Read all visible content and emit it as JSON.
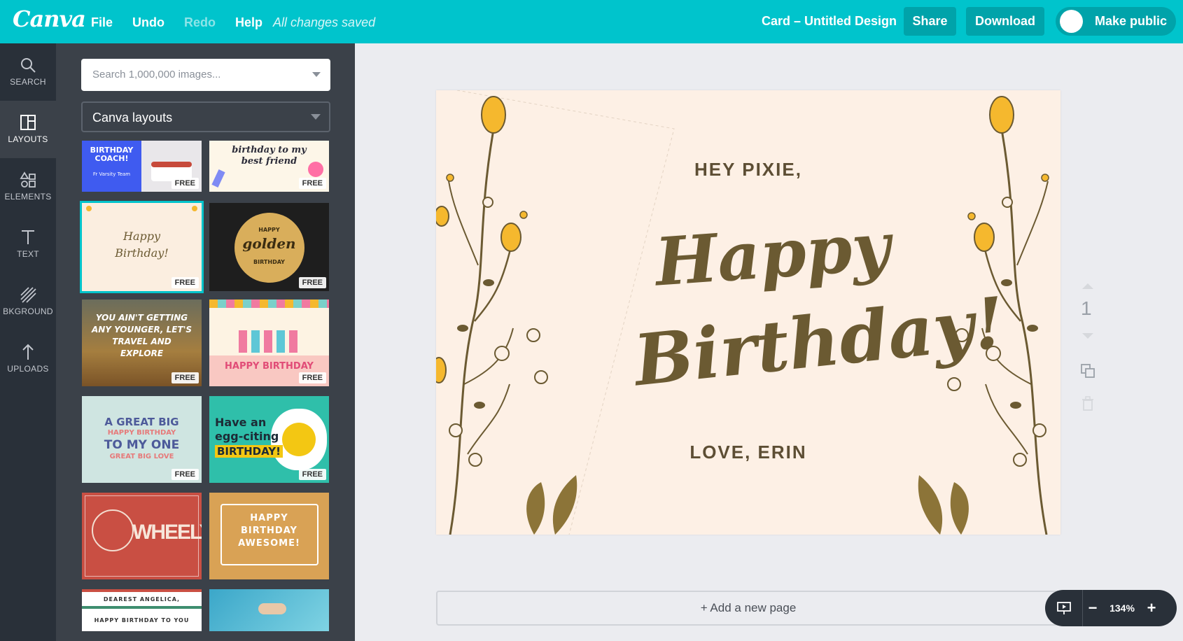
{
  "topbar": {
    "logo": "Canva",
    "menu": {
      "file": "File",
      "undo": "Undo",
      "redo": "Redo",
      "help": "Help"
    },
    "status": "All changes saved",
    "doc_title": "Card – Untitled Design",
    "share_label": "Share",
    "download_label": "Download",
    "public_label": "Make public"
  },
  "rail": {
    "search": "SEARCH",
    "layouts": "LAYOUTS",
    "elements": "ELEMENTS",
    "text": "TEXT",
    "background": "BKGROUND",
    "uploads": "UPLOADS"
  },
  "panel": {
    "search_placeholder": "Search 1,000,000 images...",
    "category": "Canva layouts",
    "free_badge": "FREE",
    "thumbs": {
      "t1": "BIRTHDAY COACH!",
      "t1b": "Fr Varsity Team",
      "t2": "birthday to my best friend",
      "t3a": "Happy",
      "t3b": "Birthday!",
      "t4a": "HAPPY",
      "t4b": "golden",
      "t4c": "BIRTHDAY",
      "t5": "YOU AIN'T GETTING ANY YOUNGER, LET'S TRAVEL AND EXPLORE",
      "t6": "HAPPY BIRTHDAY",
      "t7a": "A GREAT BIG",
      "t7b": "HAPPY BIRTHDAY",
      "t7c": "TO MY ONE",
      "t7d": "GREAT BIG LOVE",
      "t8a": "Have an",
      "t8b": "egg-citing",
      "t8c": "BIRTHDAY!",
      "t9": "WHEELY",
      "t10": "HAPPY BIRTHDAY AWESOME!",
      "t11a": "DEAREST ANGELICA,",
      "t11b": "HAPPY BIRTHDAY TO YOU"
    }
  },
  "card": {
    "greeting": "HEY PIXIE,",
    "line1": "Happy",
    "line2": "Birthday!",
    "signoff": "LOVE, ERIN"
  },
  "page_number": "1",
  "add_page": "+ Add a new page",
  "zoom": {
    "minus": "−",
    "value": "134%",
    "plus": "+"
  },
  "colors": {
    "accent": "#00c4cc",
    "rail": "#293039",
    "panel": "#3b4149",
    "card_bg": "#fdf0e5",
    "card_text": "#6b5a32",
    "flower_yellow": "#f5b82e"
  }
}
